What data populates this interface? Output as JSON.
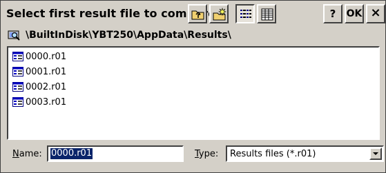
{
  "dialog": {
    "title": "Select first result file to compare",
    "toolbar": {
      "up_folder_icon": "folder-up-icon",
      "new_folder_icon": "new-folder-icon",
      "list_view_icon": "list-view-icon",
      "details_view_icon": "details-view-icon",
      "help_label": "?",
      "ok_label": "OK",
      "close_label": "×"
    },
    "path": {
      "icon": "folder-search-icon",
      "text": "\\BuiltInDisk\\YBT250\\AppData\\Results\\"
    },
    "files": [
      {
        "name": "0000.r01",
        "icon": "result-file-icon"
      },
      {
        "name": "0001.r01",
        "icon": "result-file-icon"
      },
      {
        "name": "0002.r01",
        "icon": "result-file-icon"
      },
      {
        "name": "0003.r01",
        "icon": "result-file-icon"
      }
    ],
    "name_field": {
      "label_accel": "N",
      "label_rest": "ame:",
      "value": "0000.r01"
    },
    "type_field": {
      "label_accel": "T",
      "label_rest": "ype:",
      "value": "Results files (*.r01)"
    }
  },
  "colors": {
    "window_bg": "#d4d0c8",
    "selection_bg": "#0a246a",
    "selection_fg": "#ffffff"
  }
}
